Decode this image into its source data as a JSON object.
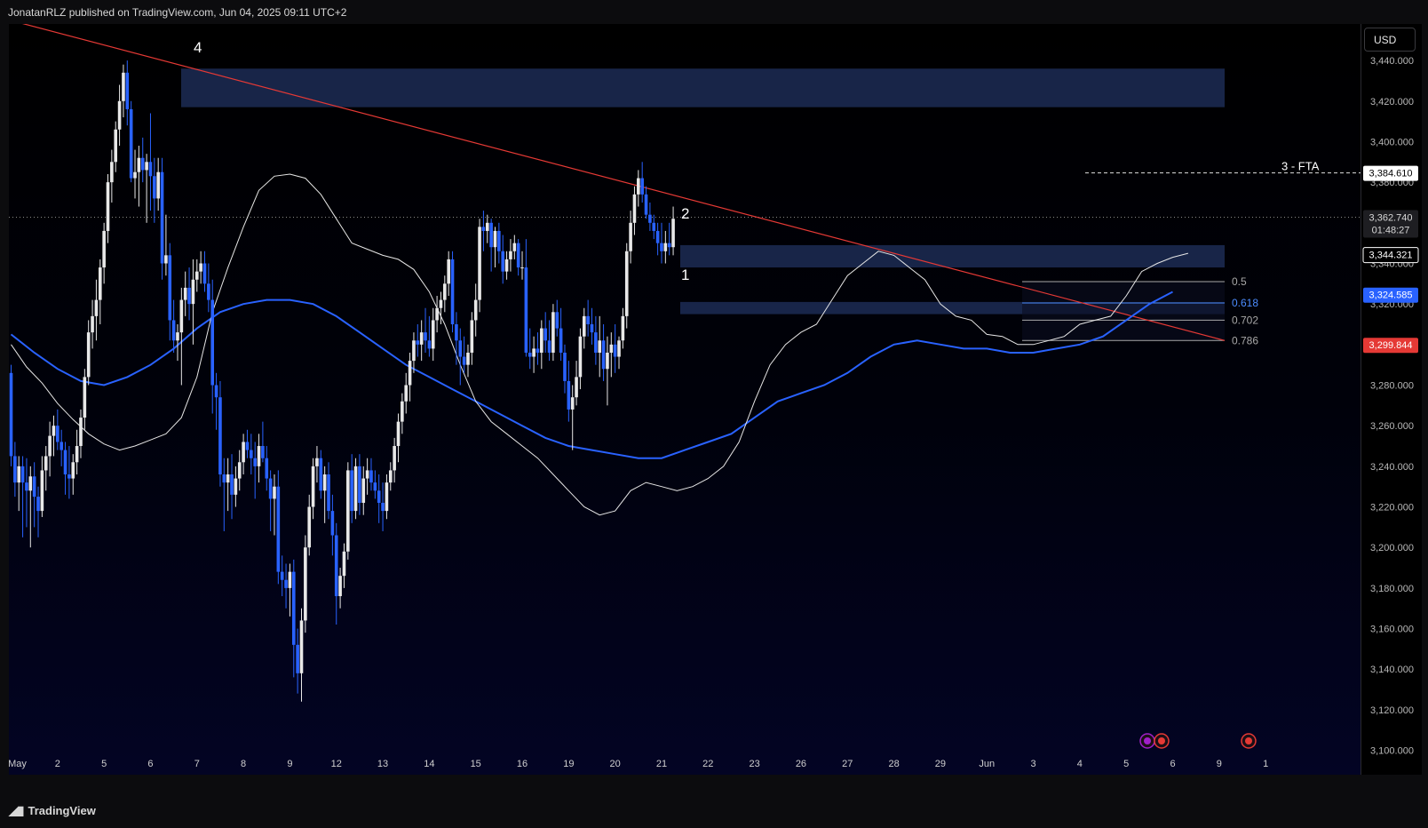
{
  "header": {
    "attribution": "JonatanRLZ published on TradingView.com, Jun 04, 2025 09:11 UTC+2"
  },
  "axis_panel": {
    "currency_label": "USD"
  },
  "footer": {
    "logo_text": "TradingView"
  },
  "colors": {
    "bull": "#e8e8e8",
    "bear": "#2962ff",
    "ema_fast": "#e6e6e6",
    "ema_slow": "#2962ff",
    "trendline": "#e53935",
    "zone": "#1c2c55",
    "price_tag": "#e53935"
  },
  "chart_data": {
    "type": "candlestick",
    "ylim": [
      3088,
      3458
    ],
    "y_ticks": [
      3100,
      3120,
      3140,
      3160,
      3180,
      3200,
      3220,
      3240,
      3260,
      3280,
      3300,
      3320,
      3340,
      3360,
      3380,
      3400,
      3420,
      3440
    ],
    "y_tick_labels": [
      "3,100.000",
      "3,120.000",
      "3,140.000",
      "3,160.000",
      "3,180.000",
      "3,200.000",
      "3,220.000",
      "3,240.000",
      "3,260.000",
      "3,280.000",
      "3,300.000",
      "3,320.000",
      "3,340.000",
      "3,360.000",
      "3,380.000",
      "3,400.000",
      "3,420.000",
      "3,440.000"
    ],
    "x_tick_labels": [
      "May",
      "2",
      "5",
      "6",
      "7",
      "8",
      "9",
      "12",
      "13",
      "14",
      "15",
      "16",
      "19",
      "20",
      "21",
      "22",
      "23",
      "26",
      "27",
      "28",
      "29",
      "Jun",
      "3",
      "4",
      "5",
      "6",
      "9",
      "1"
    ],
    "x_tick_index": [
      0,
      12,
      24,
      36,
      48,
      60,
      72,
      84,
      96,
      108,
      120,
      132,
      144,
      156,
      168,
      180,
      192,
      204,
      216,
      228,
      240,
      252,
      264,
      276,
      288,
      300,
      312,
      324
    ],
    "candles": [
      [
        3286,
        3290,
        3240,
        3245
      ],
      [
        3245,
        3252,
        3225,
        3232
      ],
      [
        3232,
        3245,
        3218,
        3240
      ],
      [
        3240,
        3245,
        3205,
        3232
      ],
      [
        3232,
        3244,
        3210,
        3228
      ],
      [
        3228,
        3240,
        3200,
        3235
      ],
      [
        3235,
        3242,
        3210,
        3225
      ],
      [
        3225,
        3230,
        3205,
        3218
      ],
      [
        3218,
        3245,
        3215,
        3238
      ],
      [
        3238,
        3250,
        3228,
        3245
      ],
      [
        3245,
        3262,
        3235,
        3255
      ],
      [
        3255,
        3265,
        3245,
        3260
      ],
      [
        3260,
        3268,
        3248,
        3252
      ],
      [
        3252,
        3258,
        3240,
        3248
      ],
      [
        3248,
        3252,
        3226,
        3236
      ],
      [
        3236,
        3250,
        3224,
        3234
      ],
      [
        3234,
        3246,
        3226,
        3242
      ],
      [
        3242,
        3258,
        3236,
        3250
      ],
      [
        3250,
        3268,
        3244,
        3264
      ],
      [
        3264,
        3288,
        3258,
        3284
      ],
      [
        3284,
        3312,
        3280,
        3306
      ],
      [
        3306,
        3322,
        3298,
        3314
      ],
      [
        3314,
        3332,
        3302,
        3322
      ],
      [
        3322,
        3342,
        3310,
        3338
      ],
      [
        3338,
        3360,
        3330,
        3356
      ],
      [
        3356,
        3384,
        3350,
        3380
      ],
      [
        3380,
        3396,
        3370,
        3390
      ],
      [
        3390,
        3410,
        3385,
        3406
      ],
      [
        3406,
        3428,
        3398,
        3420
      ],
      [
        3420,
        3438,
        3412,
        3434
      ],
      [
        3434,
        3440,
        3408,
        3416
      ],
      [
        3416,
        3420,
        3380,
        3382
      ],
      [
        3382,
        3396,
        3372,
        3385
      ],
      [
        3385,
        3398,
        3368,
        3392
      ],
      [
        3392,
        3402,
        3380,
        3386
      ],
      [
        3386,
        3394,
        3360,
        3390
      ],
      [
        3390,
        3414,
        3366,
        3383
      ],
      [
        3383,
        3392,
        3360,
        3372
      ],
      [
        3372,
        3392,
        3366,
        3385
      ],
      [
        3385,
        3392,
        3332,
        3340
      ],
      [
        3340,
        3364,
        3334,
        3344
      ],
      [
        3344,
        3350,
        3302,
        3312
      ],
      [
        3312,
        3322,
        3296,
        3302
      ],
      [
        3302,
        3310,
        3292,
        3306
      ],
      [
        3306,
        3328,
        3280,
        3322
      ],
      [
        3322,
        3336,
        3314,
        3328
      ],
      [
        3328,
        3338,
        3312,
        3320
      ],
      [
        3320,
        3342,
        3300,
        3332
      ],
      [
        3332,
        3342,
        3326,
        3336
      ],
      [
        3336,
        3346,
        3330,
        3340
      ],
      [
        3340,
        3346,
        3326,
        3330
      ],
      [
        3330,
        3340,
        3316,
        3322
      ],
      [
        3322,
        3332,
        3266,
        3280
      ],
      [
        3280,
        3286,
        3258,
        3274
      ],
      [
        3274,
        3282,
        3230,
        3236
      ],
      [
        3236,
        3244,
        3208,
        3232
      ],
      [
        3232,
        3244,
        3218,
        3236
      ],
      [
        3236,
        3246,
        3214,
        3226
      ],
      [
        3226,
        3240,
        3220,
        3234
      ],
      [
        3234,
        3248,
        3228,
        3242
      ],
      [
        3242,
        3256,
        3236,
        3252
      ],
      [
        3252,
        3258,
        3244,
        3248
      ],
      [
        3248,
        3256,
        3236,
        3244
      ],
      [
        3244,
        3252,
        3224,
        3240
      ],
      [
        3240,
        3256,
        3232,
        3250
      ],
      [
        3250,
        3262,
        3242,
        3244
      ],
      [
        3244,
        3250,
        3228,
        3234
      ],
      [
        3234,
        3238,
        3208,
        3224
      ],
      [
        3224,
        3236,
        3206,
        3230
      ],
      [
        3230,
        3238,
        3182,
        3188
      ],
      [
        3188,
        3196,
        3176,
        3184
      ],
      [
        3184,
        3192,
        3170,
        3180
      ],
      [
        3180,
        3192,
        3166,
        3188
      ],
      [
        3188,
        3194,
        3136,
        3152
      ],
      [
        3152,
        3160,
        3128,
        3138
      ],
      [
        3138,
        3170,
        3124,
        3164
      ],
      [
        3164,
        3206,
        3158,
        3200
      ],
      [
        3200,
        3226,
        3196,
        3220
      ],
      [
        3220,
        3244,
        3214,
        3240
      ],
      [
        3240,
        3250,
        3232,
        3244
      ],
      [
        3244,
        3248,
        3224,
        3228
      ],
      [
        3228,
        3240,
        3212,
        3236
      ],
      [
        3236,
        3242,
        3214,
        3218
      ],
      [
        3218,
        3226,
        3196,
        3206
      ],
      [
        3206,
        3212,
        3162,
        3176
      ],
      [
        3176,
        3190,
        3170,
        3186
      ],
      [
        3186,
        3202,
        3180,
        3198
      ],
      [
        3198,
        3242,
        3194,
        3238
      ],
      [
        3238,
        3246,
        3212,
        3218
      ],
      [
        3218,
        3244,
        3214,
        3240
      ],
      [
        3240,
        3246,
        3216,
        3222
      ],
      [
        3222,
        3240,
        3216,
        3234
      ],
      [
        3234,
        3244,
        3226,
        3238
      ],
      [
        3238,
        3244,
        3228,
        3232
      ],
      [
        3232,
        3238,
        3224,
        3228
      ],
      [
        3228,
        3236,
        3212,
        3222
      ],
      [
        3222,
        3232,
        3208,
        3218
      ],
      [
        3218,
        3236,
        3214,
        3232
      ],
      [
        3232,
        3242,
        3228,
        3238
      ],
      [
        3238,
        3254,
        3232,
        3250
      ],
      [
        3250,
        3266,
        3242,
        3262
      ],
      [
        3262,
        3276,
        3256,
        3272
      ],
      [
        3272,
        3286,
        3266,
        3280
      ],
      [
        3280,
        3296,
        3272,
        3292
      ],
      [
        3292,
        3306,
        3286,
        3302
      ],
      [
        3302,
        3310,
        3294,
        3300
      ],
      [
        3300,
        3312,
        3292,
        3306
      ],
      [
        3306,
        3318,
        3296,
        3302
      ],
      [
        3302,
        3314,
        3294,
        3298
      ],
      [
        3298,
        3318,
        3292,
        3312
      ],
      [
        3312,
        3324,
        3306,
        3318
      ],
      [
        3318,
        3326,
        3310,
        3322
      ],
      [
        3322,
        3334,
        3316,
        3330
      ],
      [
        3330,
        3346,
        3324,
        3342
      ],
      [
        3342,
        3346,
        3306,
        3310
      ],
      [
        3310,
        3316,
        3290,
        3302
      ],
      [
        3302,
        3308,
        3280,
        3294
      ],
      [
        3294,
        3304,
        3286,
        3290
      ],
      [
        3290,
        3300,
        3284,
        3296
      ],
      [
        3296,
        3316,
        3290,
        3312
      ],
      [
        3312,
        3330,
        3304,
        3322
      ],
      [
        3322,
        3362,
        3316,
        3358
      ],
      [
        3358,
        3366,
        3346,
        3356
      ],
      [
        3356,
        3364,
        3350,
        3360
      ],
      [
        3360,
        3362,
        3336,
        3348
      ],
      [
        3348,
        3358,
        3338,
        3356
      ],
      [
        3356,
        3360,
        3340,
        3346
      ],
      [
        3346,
        3354,
        3330,
        3336
      ],
      [
        3336,
        3346,
        3332,
        3342
      ],
      [
        3342,
        3352,
        3336,
        3346
      ],
      [
        3346,
        3354,
        3342,
        3350
      ],
      [
        3350,
        3352,
        3334,
        3338
      ],
      [
        3338,
        3346,
        3332,
        3338
      ],
      [
        3338,
        3352,
        3294,
        3296
      ],
      [
        3296,
        3308,
        3288,
        3294
      ],
      [
        3294,
        3304,
        3286,
        3298
      ],
      [
        3298,
        3306,
        3290,
        3296
      ],
      [
        3296,
        3312,
        3288,
        3308
      ],
      [
        3308,
        3316,
        3296,
        3302
      ],
      [
        3302,
        3312,
        3292,
        3296
      ],
      [
        3296,
        3320,
        3292,
        3316
      ],
      [
        3316,
        3322,
        3304,
        3308
      ],
      [
        3308,
        3318,
        3292,
        3296
      ],
      [
        3296,
        3300,
        3276,
        3282
      ],
      [
        3282,
        3292,
        3262,
        3268
      ],
      [
        3268,
        3280,
        3248,
        3274
      ],
      [
        3274,
        3292,
        3270,
        3284
      ],
      [
        3284,
        3308,
        3278,
        3304
      ],
      [
        3304,
        3318,
        3298,
        3314
      ],
      [
        3314,
        3322,
        3304,
        3310
      ],
      [
        3310,
        3318,
        3300,
        3306
      ],
      [
        3306,
        3314,
        3290,
        3296
      ],
      [
        3296,
        3314,
        3284,
        3302
      ],
      [
        3302,
        3310,
        3282,
        3288
      ],
      [
        3288,
        3304,
        3270,
        3296
      ],
      [
        3296,
        3306,
        3284,
        3300
      ],
      [
        3300,
        3310,
        3286,
        3294
      ],
      [
        3294,
        3304,
        3288,
        3302
      ],
      [
        3302,
        3318,
        3298,
        3314
      ],
      [
        3314,
        3350,
        3308,
        3346
      ],
      [
        3346,
        3366,
        3340,
        3360
      ],
      [
        3360,
        3378,
        3354,
        3374
      ],
      [
        3374,
        3386,
        3368,
        3382
      ],
      [
        3382,
        3390,
        3370,
        3374
      ],
      [
        3374,
        3378,
        3362,
        3364
      ],
      [
        3364,
        3370,
        3356,
        3360
      ],
      [
        3360,
        3364,
        3352,
        3356
      ],
      [
        3356,
        3360,
        3344,
        3350
      ],
      [
        3350,
        3360,
        3340,
        3346
      ],
      [
        3346,
        3356,
        3340,
        3350
      ],
      [
        3350,
        3360,
        3344,
        3348
      ],
      [
        3348,
        3368,
        3344,
        3362
      ]
    ],
    "ema_fast": [
      3300,
      3289,
      3281,
      3271,
      3263,
      3256,
      3251,
      3248,
      3250,
      3253,
      3256,
      3264,
      3284,
      3316,
      3338,
      3358,
      3376,
      3383,
      3384,
      3382,
      3374,
      3362,
      3350,
      3347,
      3344,
      3342,
      3337,
      3326,
      3310,
      3290,
      3272,
      3262,
      3256,
      3250,
      3244,
      3236,
      3228,
      3220,
      3216,
      3218,
      3228,
      3232,
      3230,
      3228,
      3230,
      3234,
      3240,
      3252,
      3272,
      3290,
      3300,
      3306,
      3310,
      3322,
      3334,
      3340,
      3346,
      3344,
      3338,
      3332,
      3320,
      3314,
      3312,
      3305,
      3304,
      3300,
      3300,
      3302,
      3304,
      3310,
      3312,
      3314,
      3324,
      3336,
      3340,
      3343,
      3345
    ],
    "ema_fast_index": [
      0,
      4,
      8,
      12,
      16,
      20,
      24,
      28,
      32,
      36,
      40,
      44,
      48,
      52,
      56,
      60,
      64,
      68,
      72,
      76,
      80,
      84,
      88,
      92,
      96,
      100,
      104,
      108,
      112,
      116,
      120,
      124,
      128,
      132,
      136,
      140,
      144,
      148,
      152,
      156,
      160,
      164,
      168,
      172,
      176,
      180,
      184,
      188,
      192,
      196,
      200,
      204,
      208,
      212,
      216,
      220,
      224,
      228,
      232,
      236,
      240,
      244,
      248,
      252,
      256,
      260,
      264,
      268,
      272,
      276,
      280,
      284,
      288,
      292,
      296,
      300,
      304
    ],
    "ema_slow": [
      3305,
      3296,
      3288,
      3282,
      3280,
      3284,
      3290,
      3298,
      3308,
      3316,
      3320,
      3322,
      3322,
      3320,
      3314,
      3306,
      3298,
      3290,
      3284,
      3278,
      3272,
      3266,
      3260,
      3254,
      3250,
      3248,
      3246,
      3244,
      3244,
      3248,
      3252,
      3256,
      3264,
      3272,
      3276,
      3280,
      3286,
      3294,
      3300,
      3302,
      3300,
      3298,
      3298,
      3296,
      3296,
      3298,
      3300,
      3304,
      3312,
      3320,
      3326
    ],
    "ema_slow_index": [
      0,
      6,
      12,
      18,
      24,
      30,
      36,
      42,
      48,
      54,
      60,
      66,
      72,
      78,
      84,
      90,
      96,
      102,
      108,
      114,
      120,
      126,
      132,
      138,
      144,
      150,
      156,
      162,
      168,
      174,
      180,
      186,
      192,
      198,
      204,
      210,
      216,
      222,
      228,
      234,
      240,
      246,
      252,
      258,
      264,
      270,
      276,
      282,
      288,
      294,
      300
    ],
    "annotations": [
      "4",
      "2",
      "1",
      "3 - FTA"
    ],
    "fib_levels": [
      {
        "label": "0.5",
        "value": 3331
      },
      {
        "label": "0.618",
        "value": 3320.5
      },
      {
        "label": "0.702",
        "value": 3312
      },
      {
        "label": "0.786",
        "value": 3302
      }
    ],
    "price_tags": [
      {
        "value": 3384.61,
        "label": "3,384.610",
        "style": "white"
      },
      {
        "value": 3362.74,
        "label": "3,362.740",
        "sublabel": "01:48:27",
        "style": "dark"
      },
      {
        "value": 3344.321,
        "label": "3,344.321",
        "style": "black"
      },
      {
        "value": 3324.585,
        "label": "3,324.585",
        "style": "blue"
      },
      {
        "value": 3299.844,
        "label": "3,299.844",
        "style": "red"
      }
    ],
    "zones": [
      {
        "y_top": 3436,
        "y_bottom": 3417
      },
      {
        "y_top": 3349,
        "y_bottom": 3338
      },
      {
        "y_top": 3321,
        "y_bottom": 3315
      }
    ]
  }
}
